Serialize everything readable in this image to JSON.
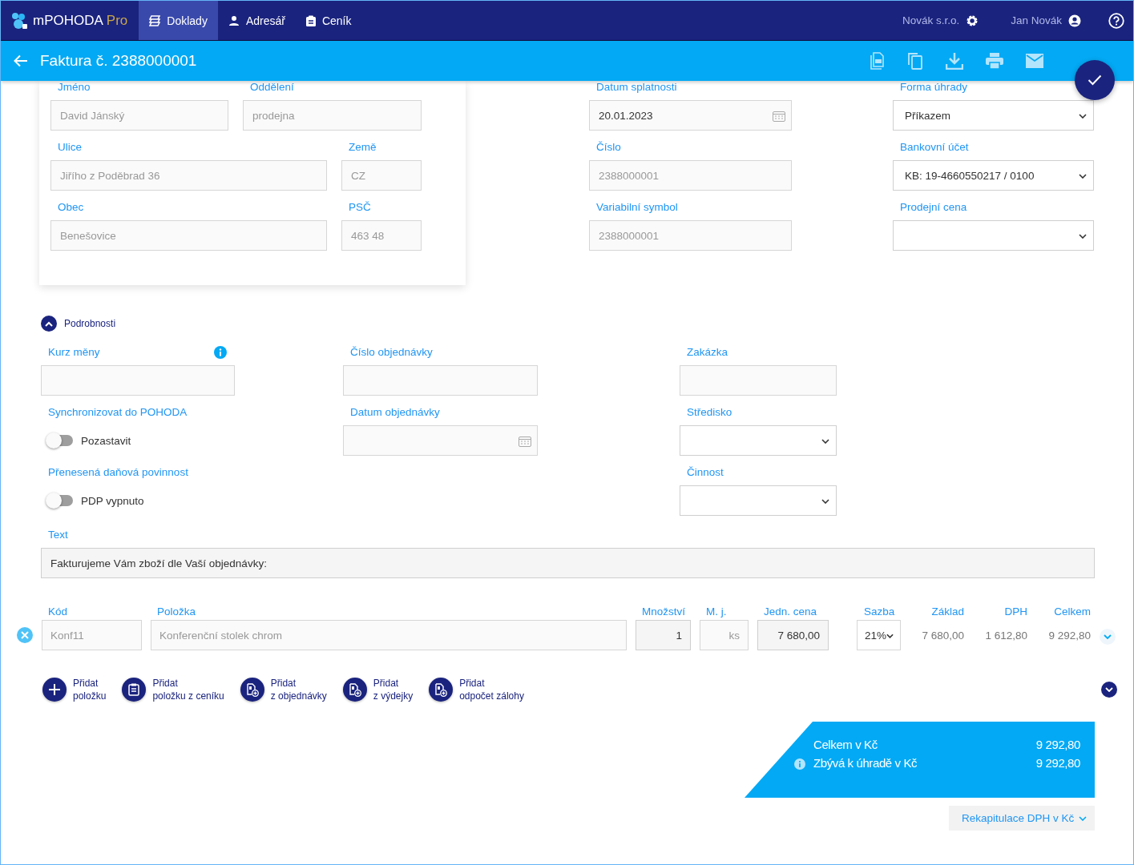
{
  "app": {
    "name": "mPOHODA",
    "edition": "Pro"
  },
  "nav": [
    {
      "label": "Doklady",
      "kind": "documents",
      "selected": true
    },
    {
      "label": "Adresář",
      "kind": "person",
      "selected": false
    },
    {
      "label": "Ceník",
      "kind": "clipboard",
      "selected": false
    }
  ],
  "account": {
    "company": "Novák s.r.o.",
    "user": "Jan Novák"
  },
  "document": {
    "title": "Faktura č. 2388000001"
  },
  "customer_card": {
    "rows": [
      [
        {
          "label": "Jméno",
          "value": "David Jánský",
          "disabled": true
        },
        {
          "label": "Oddělení",
          "value": "prodejna",
          "disabled": true
        }
      ],
      [
        {
          "label": "Ulice",
          "value": "Jiřího z Poděbrad 36",
          "disabled": true
        },
        {
          "label": "Země",
          "value": "CZ",
          "disabled": true
        }
      ],
      [
        {
          "label": "Obec",
          "value": "Benešovice",
          "disabled": true
        },
        {
          "label": "PSČ",
          "value": "463 48",
          "disabled": true
        }
      ]
    ]
  },
  "header_columns": [
    {
      "fields": [
        {
          "label": "Datum splatnosti",
          "kind": "date",
          "value": "20.01.2023",
          "disabled": false
        },
        {
          "label": "Číslo",
          "kind": "text",
          "value": "2388000001",
          "disabled": true
        },
        {
          "label": "Variabilní symbol",
          "kind": "text",
          "value": "2388000001",
          "disabled": true
        }
      ]
    },
    {
      "fields": [
        {
          "label": "Forma úhrady",
          "kind": "select",
          "value": "Příkazem",
          "disabled": false
        },
        {
          "label": "Bankovní účet",
          "kind": "select",
          "value": "KB: 19-4660550217 / 0100",
          "disabled": false
        },
        {
          "label": "Prodejní cena",
          "kind": "select"
        }
      ]
    }
  ],
  "details": {
    "label": "Podrobnosti",
    "expanded": true,
    "columns": [
      {
        "fields": [
          {
            "label": "Kurz měny",
            "kind": "text",
            "info": true
          },
          {
            "label": "Synchronizovat do POHODA",
            "kind": "toggle",
            "on": false,
            "text": "Pozastavit"
          },
          {
            "label": "Přenesená daňová povinnost",
            "kind": "toggle",
            "on": false,
            "text": "PDP vypnuto"
          }
        ]
      },
      {
        "fields": [
          {
            "label": "Číslo objednávky",
            "kind": "text",
            "info": false
          },
          {
            "label": "Datum objednávky",
            "kind": "date"
          }
        ]
      },
      {
        "fields": [
          {
            "label": "Zakázka",
            "kind": "text",
            "info": false
          },
          {
            "label": "Středisko",
            "kind": "select"
          },
          {
            "label": "Činnost",
            "kind": "select"
          }
        ]
      }
    ]
  },
  "text_field": {
    "label": "Text",
    "value": "Fakturujeme Vám zboží dle Vaší objednávky:"
  },
  "items": {
    "columns": [
      "Kód",
      "Položka",
      "Množství",
      "M. j.",
      "Jedn. cena",
      "Sazba",
      "Základ",
      "DPH",
      "Celkem"
    ],
    "rows": [
      {
        "cells": [
          "Konf11",
          "Konferenční stolek chrom",
          "1",
          "ks",
          "7 680,00",
          "21%",
          "7 680,00",
          "1 612,80",
          "9 292,80"
        ],
        "expanded": false
      }
    ]
  },
  "add_actions": [
    {
      "kind": "plus",
      "lines": [
        "Přidat",
        "položku"
      ]
    },
    {
      "kind": "pricelist",
      "lines": [
        "Přidat",
        "položku z ceníku"
      ]
    },
    {
      "kind": "order",
      "lines": [
        "Přidat",
        "z objednávky"
      ]
    },
    {
      "kind": "issue",
      "lines": [
        "Přidat",
        "z výdejky"
      ]
    },
    {
      "kind": "advance",
      "lines": [
        "Přidat",
        "odpočet zálohy"
      ]
    }
  ],
  "totals": {
    "rows": [
      {
        "label": "Celkem v Kč",
        "value": "9 292,80",
        "info": false
      },
      {
        "label": "Zbývá k úhradě v Kč",
        "value": "9 292,80",
        "info": true
      }
    ]
  },
  "vat_summary": {
    "label": "Rekapitulace DPH v Kč",
    "expanded": false
  }
}
